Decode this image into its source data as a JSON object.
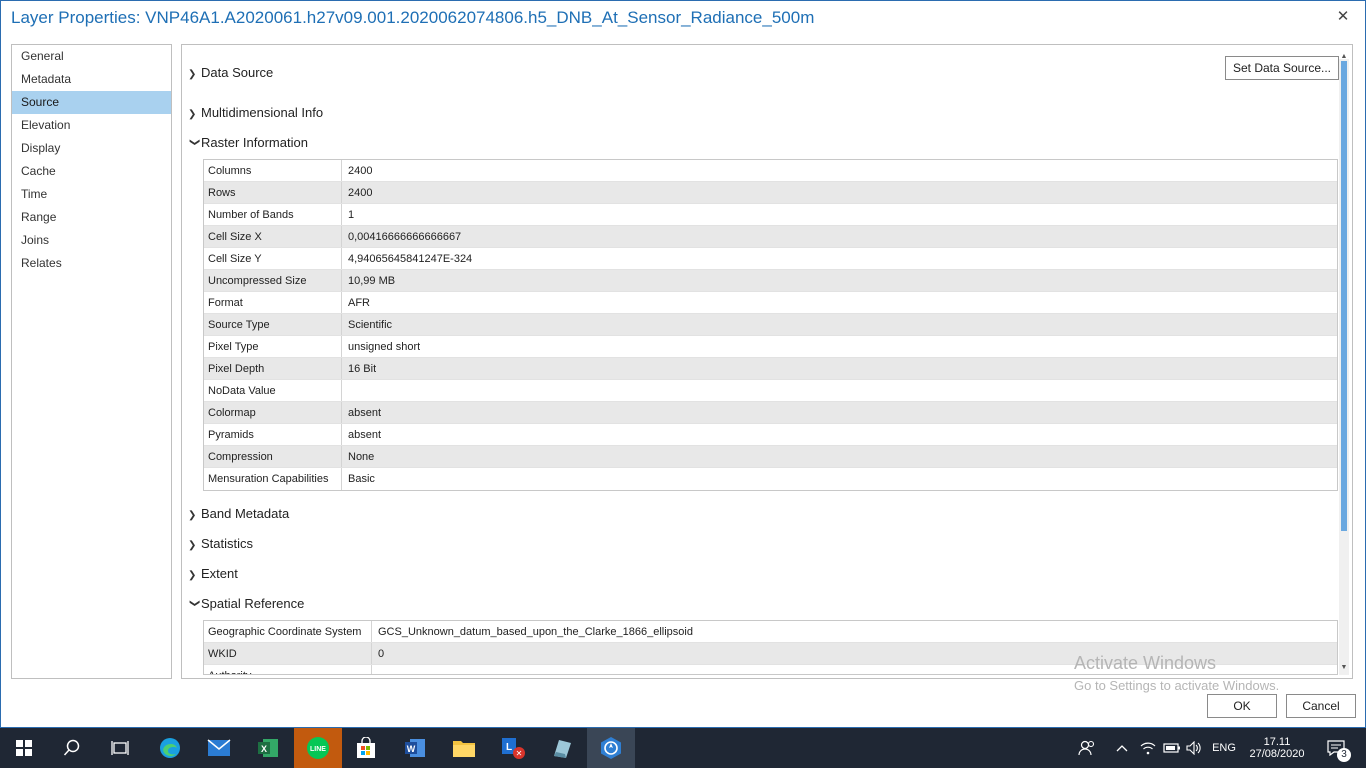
{
  "window": {
    "title": "Layer Properties: VNP46A1.A2020061.h27v09.001.2020062074806.h5_DNB_At_Sensor_Radiance_500m"
  },
  "nav": {
    "items": [
      {
        "label": "General",
        "name": "general"
      },
      {
        "label": "Metadata",
        "name": "metadata"
      },
      {
        "label": "Source",
        "name": "source",
        "active": true
      },
      {
        "label": "Elevation",
        "name": "elevation"
      },
      {
        "label": "Display",
        "name": "display"
      },
      {
        "label": "Cache",
        "name": "cache"
      },
      {
        "label": "Time",
        "name": "time"
      },
      {
        "label": "Range",
        "name": "range"
      },
      {
        "label": "Joins",
        "name": "joins"
      },
      {
        "label": "Relates",
        "name": "relates"
      }
    ]
  },
  "main": {
    "set_data_source_label": "Set Data Source...",
    "sections": {
      "data_source": "Data Source",
      "multidimensional_info": "Multidimensional Info",
      "raster_information": "Raster Information",
      "band_metadata": "Band Metadata",
      "statistics": "Statistics",
      "extent": "Extent",
      "spatial_reference": "Spatial Reference"
    },
    "raster_info": [
      {
        "key": "Columns",
        "value": "2400"
      },
      {
        "key": "Rows",
        "value": "2400"
      },
      {
        "key": "Number of Bands",
        "value": "1"
      },
      {
        "key": "Cell Size X",
        "value": "0,00416666666666667"
      },
      {
        "key": "Cell Size Y",
        "value": "4,94065645841247E-324"
      },
      {
        "key": "Uncompressed Size",
        "value": "10,99 MB"
      },
      {
        "key": "Format",
        "value": "AFR"
      },
      {
        "key": "Source Type",
        "value": "Scientific"
      },
      {
        "key": "Pixel Type",
        "value": "unsigned short"
      },
      {
        "key": "Pixel Depth",
        "value": "16 Bit"
      },
      {
        "key": "NoData Value",
        "value": ""
      },
      {
        "key": "Colormap",
        "value": "absent"
      },
      {
        "key": "Pyramids",
        "value": "absent"
      },
      {
        "key": "Compression",
        "value": "None"
      },
      {
        "key": "Mensuration Capabilities",
        "value": "Basic"
      }
    ],
    "spatial_reference": [
      {
        "key": "Geographic Coordinate System",
        "value": "GCS_Unknown_datum_based_upon_the_Clarke_1866_ellipsoid"
      },
      {
        "key": "WKID",
        "value": "0"
      },
      {
        "key": "Authority",
        "value": ""
      }
    ]
  },
  "watermark": {
    "line1": "Activate Windows",
    "line2": "Go to Settings to activate Windows."
  },
  "buttons": {
    "ok": "OK",
    "cancel": "Cancel"
  },
  "taskbar": {
    "language": "ENG",
    "time": "17.11",
    "date": "27/08/2020",
    "notification_count": "3"
  },
  "colors": {
    "accent": "#1e6fb5",
    "nav_selected": "#a9d1ef",
    "taskbar": "#1f2734",
    "active_app": "#c25a0e"
  }
}
